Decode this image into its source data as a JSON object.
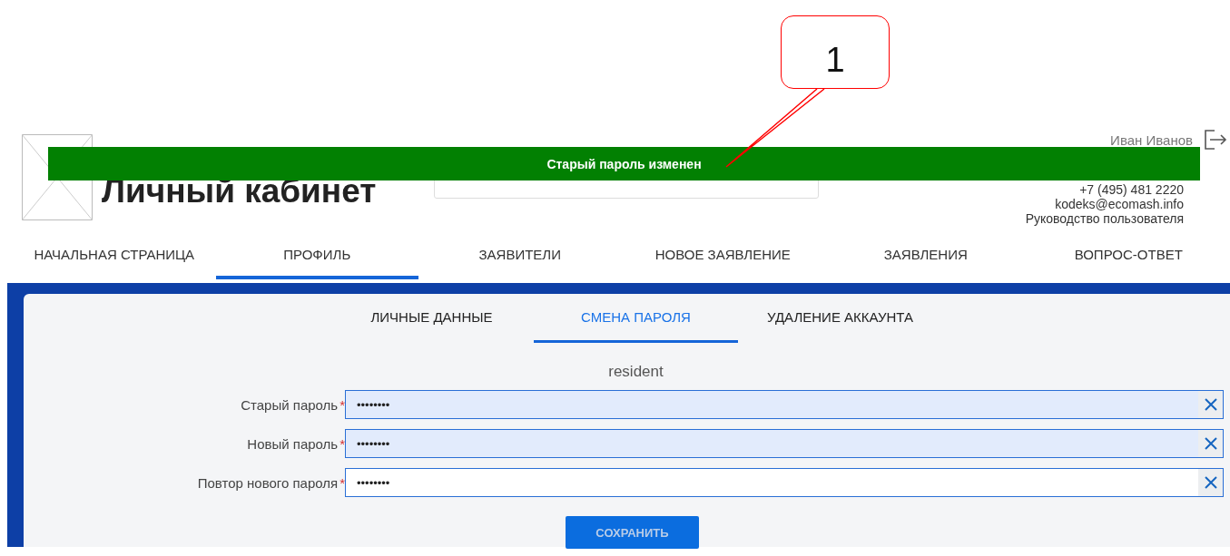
{
  "callout": {
    "label": "1"
  },
  "header": {
    "title": "Личный кабинет",
    "user_name": "Иван Иванов",
    "phone": "+7 (495) 481 2220",
    "email": "kodeks@ecomash.info",
    "manual_link": "Руководство пользователя"
  },
  "notification": {
    "text": "Старый пароль изменен"
  },
  "nav": [
    {
      "label": "НАЧАЛЬНАЯ СТРАНИЦА",
      "selected": false
    },
    {
      "label": "ПРОФИЛЬ",
      "selected": true
    },
    {
      "label": "ЗАЯВИТЕЛИ",
      "selected": false
    },
    {
      "label": "НОВОЕ ЗАЯВЛЕНИЕ",
      "selected": false
    },
    {
      "label": "ЗАЯВЛЕНИЯ",
      "selected": false
    },
    {
      "label": "ВОПРОС-ОТВЕТ",
      "selected": false
    }
  ],
  "profile_tabs": [
    {
      "label": "ЛИЧНЫЕ ДАННЫЕ",
      "selected": false
    },
    {
      "label": "СМЕНА ПАРОЛЯ",
      "selected": true
    },
    {
      "label": "УДАЛЕНИЕ АККАУНТА",
      "selected": false
    }
  ],
  "login": "resident",
  "fields": [
    {
      "label": "Старый пароль",
      "required": true,
      "value": "••••••••",
      "autofilled": true
    },
    {
      "label": "Новый пароль",
      "required": true,
      "value": "••••••••",
      "autofilled": true
    },
    {
      "label": "Повтор нового пароля",
      "required": true,
      "value": "••••••••",
      "autofilled": false
    }
  ],
  "required_mark": "*",
  "save_button": "СОХРАНИТЬ"
}
